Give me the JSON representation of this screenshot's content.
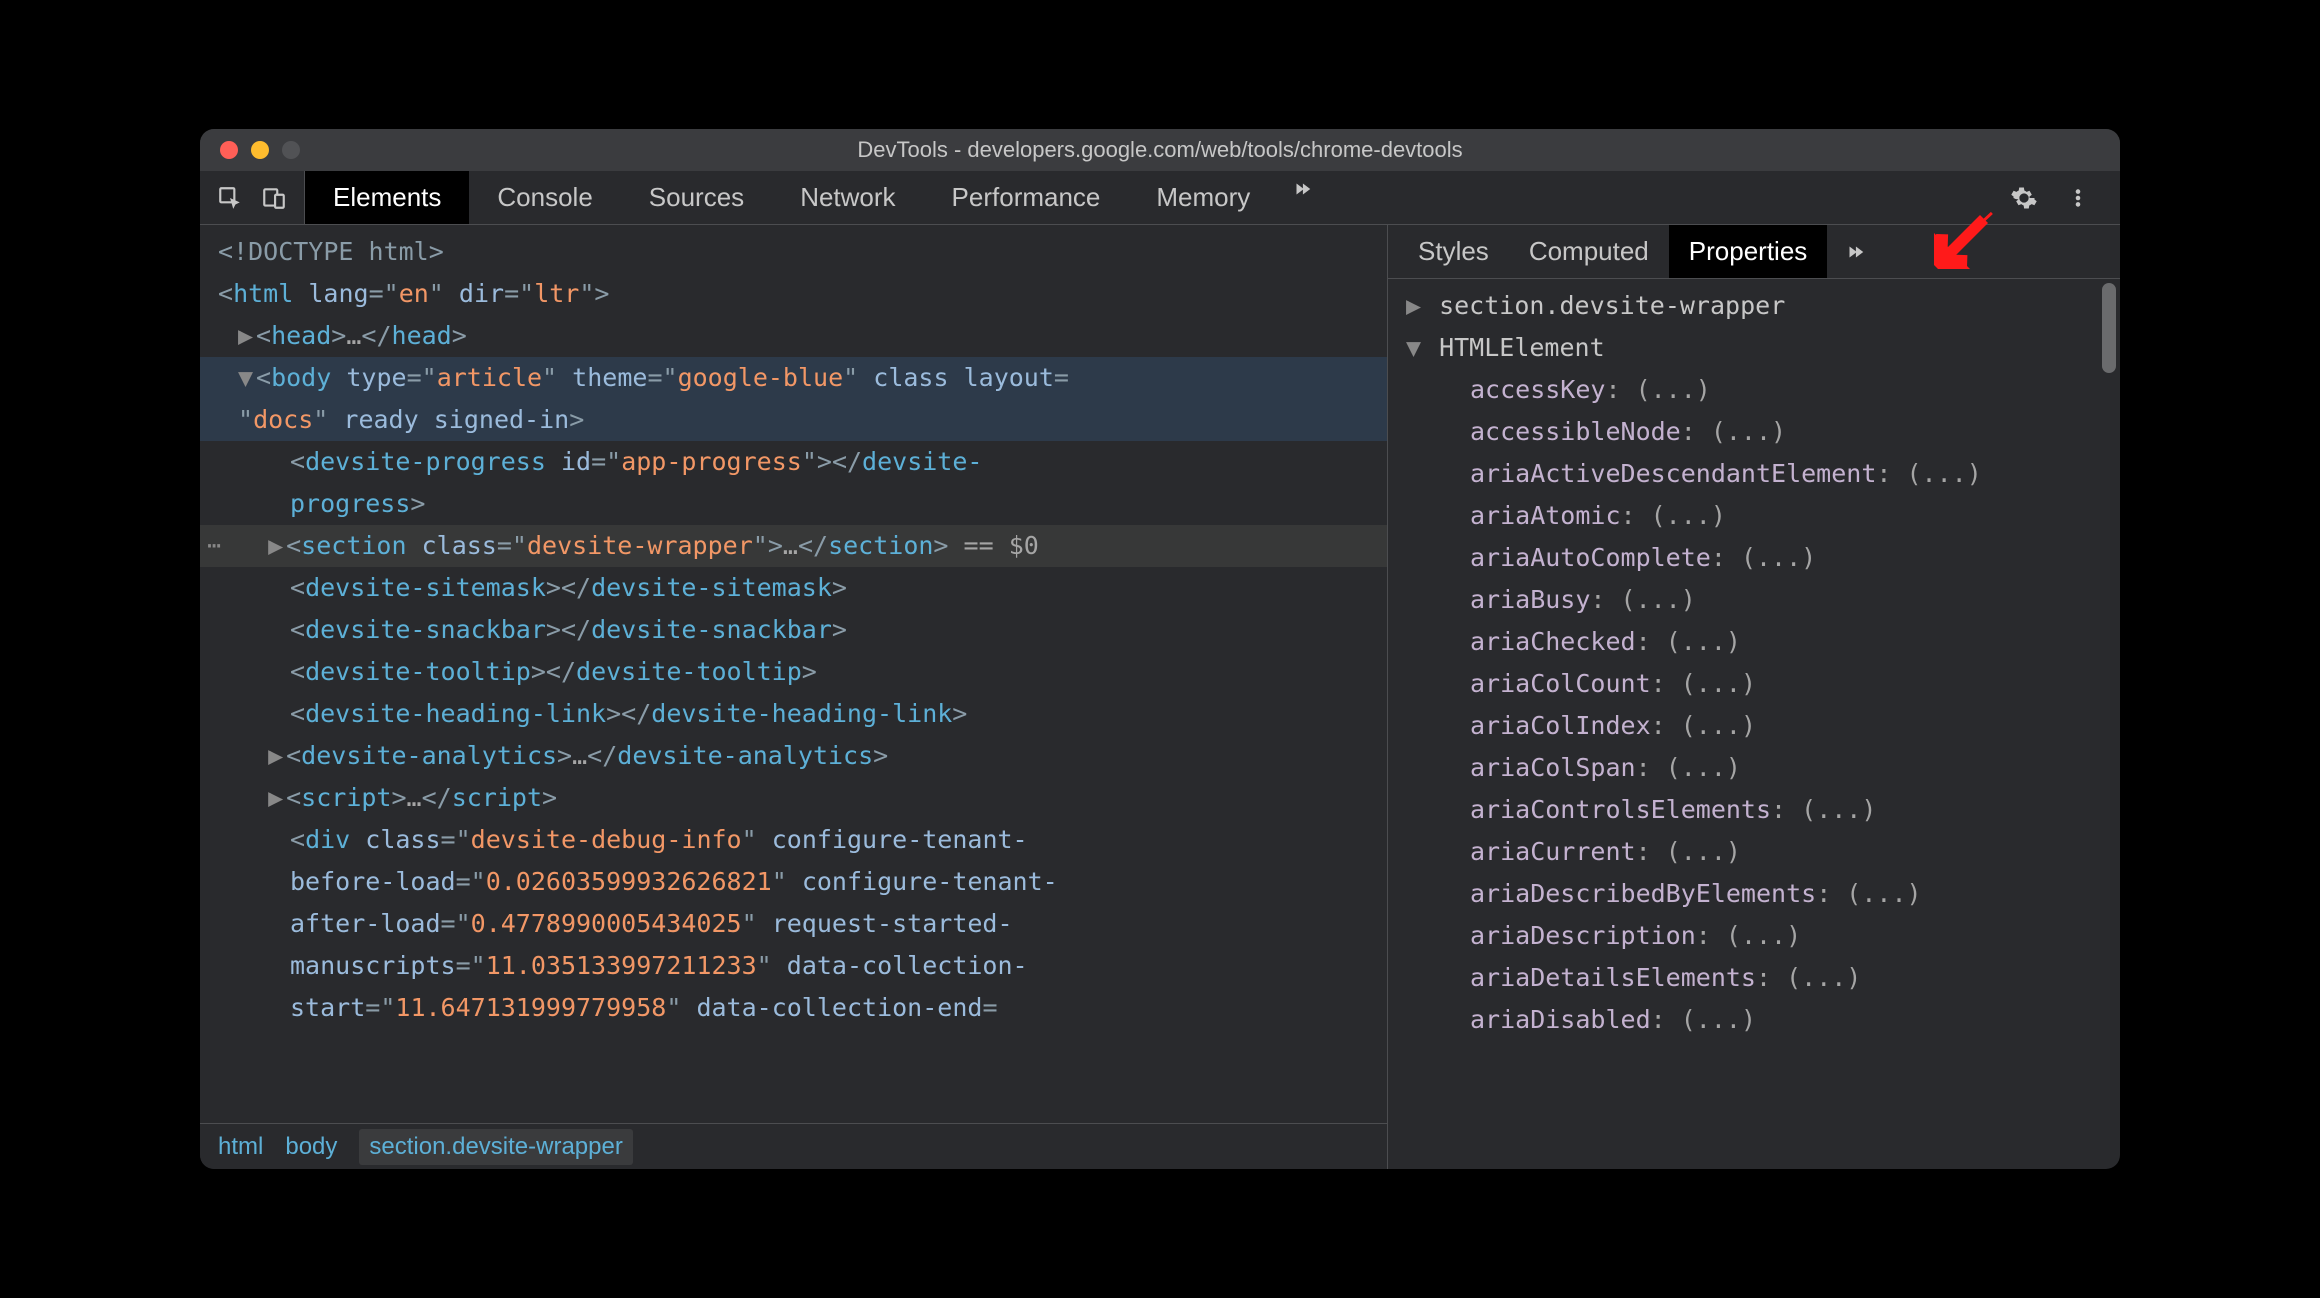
{
  "window": {
    "title": "DevTools - developers.google.com/web/tools/chrome-devtools"
  },
  "mainTabs": [
    "Elements",
    "Console",
    "Sources",
    "Network",
    "Performance",
    "Memory"
  ],
  "activeMainTab": "Elements",
  "sideTabs": [
    "Styles",
    "Computed",
    "Properties"
  ],
  "activeSideTab": "Properties",
  "breadcrumbs": [
    {
      "label": "html",
      "active": false
    },
    {
      "label": "body",
      "active": false
    },
    {
      "label": "section.devsite-wrapper",
      "active": true
    }
  ],
  "dom": {
    "doctype": "<!DOCTYPE html>",
    "htmlOpen": {
      "tag": "html",
      "attrs": [
        [
          "lang",
          "en"
        ],
        [
          "dir",
          "ltr"
        ]
      ]
    },
    "head": {
      "tag": "head"
    },
    "bodyOpen": {
      "tag": "body",
      "attrs": [
        [
          "type",
          "article"
        ],
        [
          "theme",
          "google-blue"
        ]
      ],
      "bareAttrs": [
        "class"
      ],
      "layoutAttr": "layout",
      "layoutVal": "docs",
      "trailingBare": [
        "ready",
        "signed-in"
      ]
    },
    "devsiteProgress": {
      "tag": "devsite-progress",
      "idval": "app-progress"
    },
    "section": {
      "tag": "section",
      "classval": "devsite-wrapper",
      "refsel": "== $0"
    },
    "sitemask": "devsite-sitemask",
    "snackbar": "devsite-snackbar",
    "tooltip": "devsite-tooltip",
    "headingLink": "devsite-heading-link",
    "analytics": "devsite-analytics",
    "script": "script",
    "debugDiv": {
      "tag": "div",
      "classval": "devsite-debug-info",
      "parts": [
        [
          "configure-tenant-before-load",
          "0.02603599932626821"
        ],
        [
          "configure-tenant-after-load",
          "0.4778990005434025"
        ],
        [
          "request-started-manuscripts",
          "11.035133997211233"
        ],
        [
          "data-collection-start",
          "11.647131999779958"
        ]
      ],
      "trailingAttr": "data-collection-end"
    }
  },
  "properties": {
    "header1": "section.devsite-wrapper",
    "header2": "HTMLElement",
    "ellipsis": "(...)",
    "items": [
      "accessKey",
      "accessibleNode",
      "ariaActiveDescendantElement",
      "ariaAtomic",
      "ariaAutoComplete",
      "ariaBusy",
      "ariaChecked",
      "ariaColCount",
      "ariaColIndex",
      "ariaColSpan",
      "ariaControlsElements",
      "ariaCurrent",
      "ariaDescribedByElements",
      "ariaDescription",
      "ariaDetailsElements",
      "ariaDisabled"
    ]
  }
}
